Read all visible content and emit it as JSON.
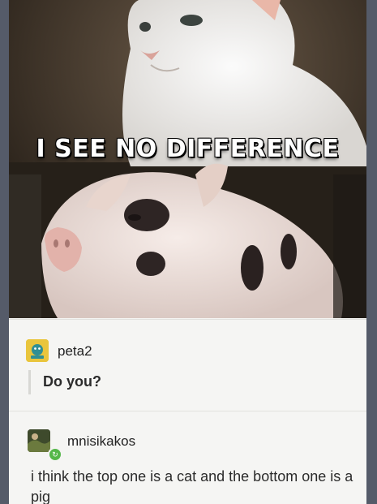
{
  "post": {
    "image": {
      "caption": "I SEE NO DIFFERENCE",
      "top_subject": "white kitten",
      "bottom_subject": "spotted piglet"
    }
  },
  "reblogs": [
    {
      "username": "peta2",
      "avatar_icon": "peta2-avatar-icon",
      "avatar_color": "#e9c53c",
      "text": "Do you?"
    },
    {
      "username": "mnisikakos",
      "avatar_icon": "user-avatar-icon",
      "badge_icon": "reblog-badge-icon",
      "badge_color": "#55b749",
      "text": "i think the top one is a cat and the bottom one is a pig"
    }
  ]
}
